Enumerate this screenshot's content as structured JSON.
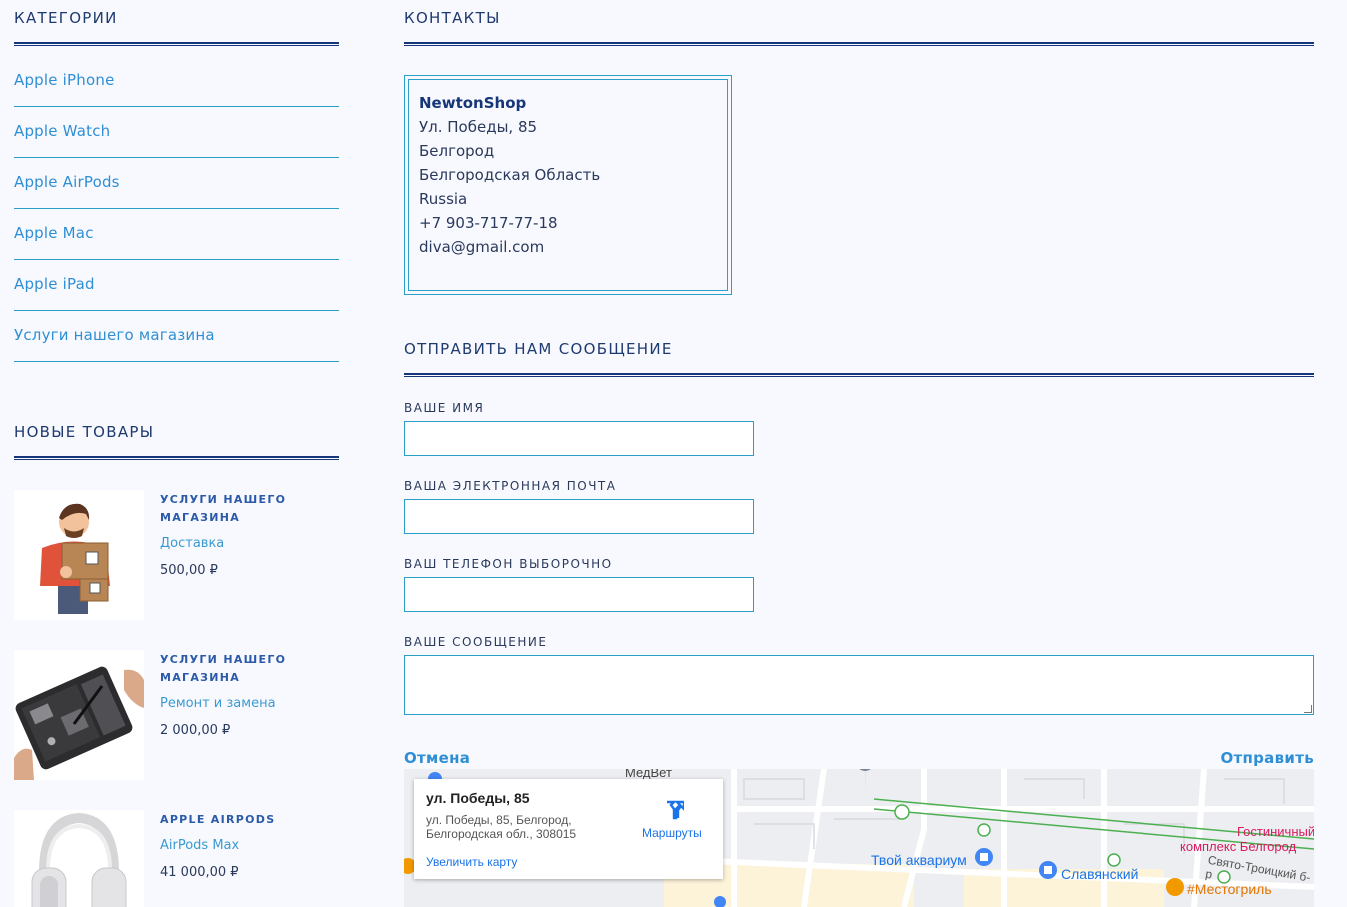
{
  "sidebar": {
    "categories_title": "КАТЕГОРИИ",
    "categories": [
      "Apple iPhone",
      "Apple Watch",
      "Apple AirPods",
      "Apple Mac",
      "Apple iPad",
      "Услуги нашего магазина"
    ],
    "new_products_title": "НОВЫЕ ТОВАРЫ",
    "products": [
      {
        "title": "УСЛУГИ НАШЕГО МАГАЗИНА",
        "subtitle": "Доставка",
        "price": "500,00 ₽"
      },
      {
        "title": "УСЛУГИ НАШЕГО МАГАЗИНА",
        "subtitle": "Ремонт и замена",
        "price": "2 000,00 ₽"
      },
      {
        "title": "APPLE AIRPODS",
        "subtitle": "AirPods Max",
        "price": "41 000,00 ₽"
      }
    ]
  },
  "contacts": {
    "title": "КОНТАКТЫ",
    "name": "NewtonShop",
    "street": "Ул. Победы, 85",
    "city": "Белгород",
    "region": "Белгородская Область",
    "country": "Russia",
    "phone": "+7 903-717-77-18",
    "email": "diva@gmail.com"
  },
  "form": {
    "title": "ОТПРАВИТЬ НАМ СООБЩЕНИЕ",
    "name_label": "ВАШЕ ИМЯ",
    "email_label": "ВАША ЭЛЕКТРОННАЯ ПОЧТА",
    "phone_label": "ВАШ ТЕЛЕФОН ВЫБОРОЧНО",
    "message_label": "ВАШЕ СООБЩЕНИЕ",
    "cancel": "Отмена",
    "submit": "Отправить"
  },
  "map": {
    "card_title": "ул. Победы, 85",
    "card_address": "ул. Победы, 85, Белгород, Белгородская обл., 308015",
    "enlarge": "Увеличить карту",
    "routes": "Маршруты",
    "labels": {
      "medvet": "МедВет",
      "aquarium": "Твой аквариум",
      "slavyansky": "Славянский",
      "hotel": "Гостиничный комплекс Белгород",
      "hotel_line1": "Гостиничный",
      "hotel_line2": "комплекс Белгород",
      "mestogril": "#Местогриль",
      "street": "Свято-Троицкий б-р"
    },
    "colors": {
      "pin": "#4285f4",
      "food": "#f29900",
      "hotel": "#d81b60",
      "transit": "#34a853"
    }
  }
}
